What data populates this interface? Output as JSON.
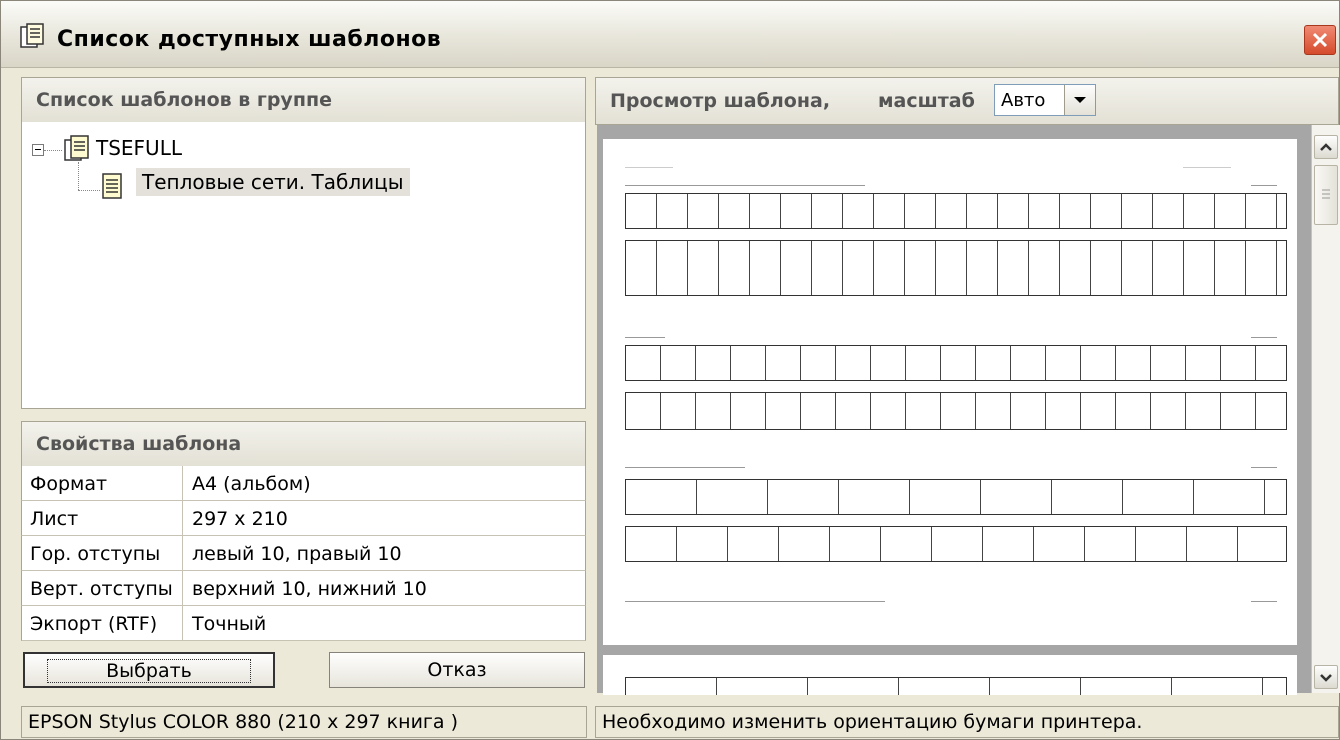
{
  "window": {
    "title": "Список доступных шаблонов",
    "title_icon": "document-list-icon",
    "close_icon": "close-icon"
  },
  "template_list": {
    "header": "Список шаблонов в группе",
    "tree": [
      {
        "label": "TSEFULL",
        "expanded": true,
        "icon": "document-group-icon",
        "children": [
          {
            "label": "Тепловые сети. Таблицы",
            "selected": true,
            "icon": "document-icon"
          }
        ]
      }
    ]
  },
  "properties": {
    "header": "Свойства шаблона",
    "rows": [
      {
        "key": "Формат",
        "value": "А4 (альбом)"
      },
      {
        "key": "Лист",
        "value": "297 x 210"
      },
      {
        "key": "Гор. отступы",
        "value": "левый 10,  правый 10"
      },
      {
        "key": "Верт. отступы",
        "value": "верхний 10,  нижний 10"
      },
      {
        "key": "Экпорт (RTF)",
        "value": "Точный"
      }
    ]
  },
  "buttons": {
    "select": "Выбрать",
    "cancel": "Отказ"
  },
  "preview": {
    "header_label": "Просмотр шаблона,",
    "scale_label": "масштаб",
    "scale_value": "Авто"
  },
  "status": {
    "printer": "EPSON Stylus COLOR 880 (210 x 297 книга )",
    "message": "Необходимо изменить ориентацию бумаги принтера."
  },
  "colors": {
    "background": "#ece9d8",
    "close_button": "#d54b2c",
    "selection": "#e3e1d9"
  }
}
